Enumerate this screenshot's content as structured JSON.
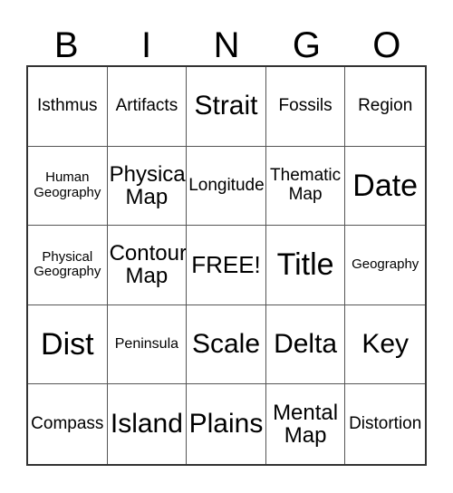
{
  "card": {
    "title_letters": [
      "B",
      "I",
      "N",
      "G",
      "O"
    ],
    "rows": [
      [
        {
          "text": "Isthmus",
          "size": "m"
        },
        {
          "text": "Artifacts",
          "size": "m"
        },
        {
          "text": "Strait",
          "size": "xxl"
        },
        {
          "text": "Fossils",
          "size": "m"
        },
        {
          "text": "Region",
          "size": "m"
        }
      ],
      [
        {
          "text": "Human\nGeography",
          "size": "xs"
        },
        {
          "text": "Physical\nMap",
          "size": "l"
        },
        {
          "text": "Longitude",
          "size": "m"
        },
        {
          "text": "Thematic\nMap",
          "size": "m"
        },
        {
          "text": "Date",
          "size": "huge"
        }
      ],
      [
        {
          "text": "Physical\nGeography",
          "size": "xs"
        },
        {
          "text": "Contour\nMap",
          "size": "l"
        },
        {
          "text": "FREE!",
          "size": "xl"
        },
        {
          "text": "Title",
          "size": "huge"
        },
        {
          "text": "Geography",
          "size": "xs"
        }
      ],
      [
        {
          "text": "Dist",
          "size": "huge"
        },
        {
          "text": "Peninsula",
          "size": "s"
        },
        {
          "text": "Scale",
          "size": "xxl"
        },
        {
          "text": "Delta",
          "size": "xxl"
        },
        {
          "text": "Key",
          "size": "xxl"
        }
      ],
      [
        {
          "text": "Compass",
          "size": "m"
        },
        {
          "text": "Island",
          "size": "xxl"
        },
        {
          "text": "Plains",
          "size": "xxl"
        },
        {
          "text": "Mental\nMap",
          "size": "l"
        },
        {
          "text": "Distortion",
          "size": "m"
        }
      ]
    ],
    "colors": {
      "background": "#ffffff",
      "text": "#000000",
      "outer_border": "#333333",
      "inner_border": "#555555"
    }
  }
}
